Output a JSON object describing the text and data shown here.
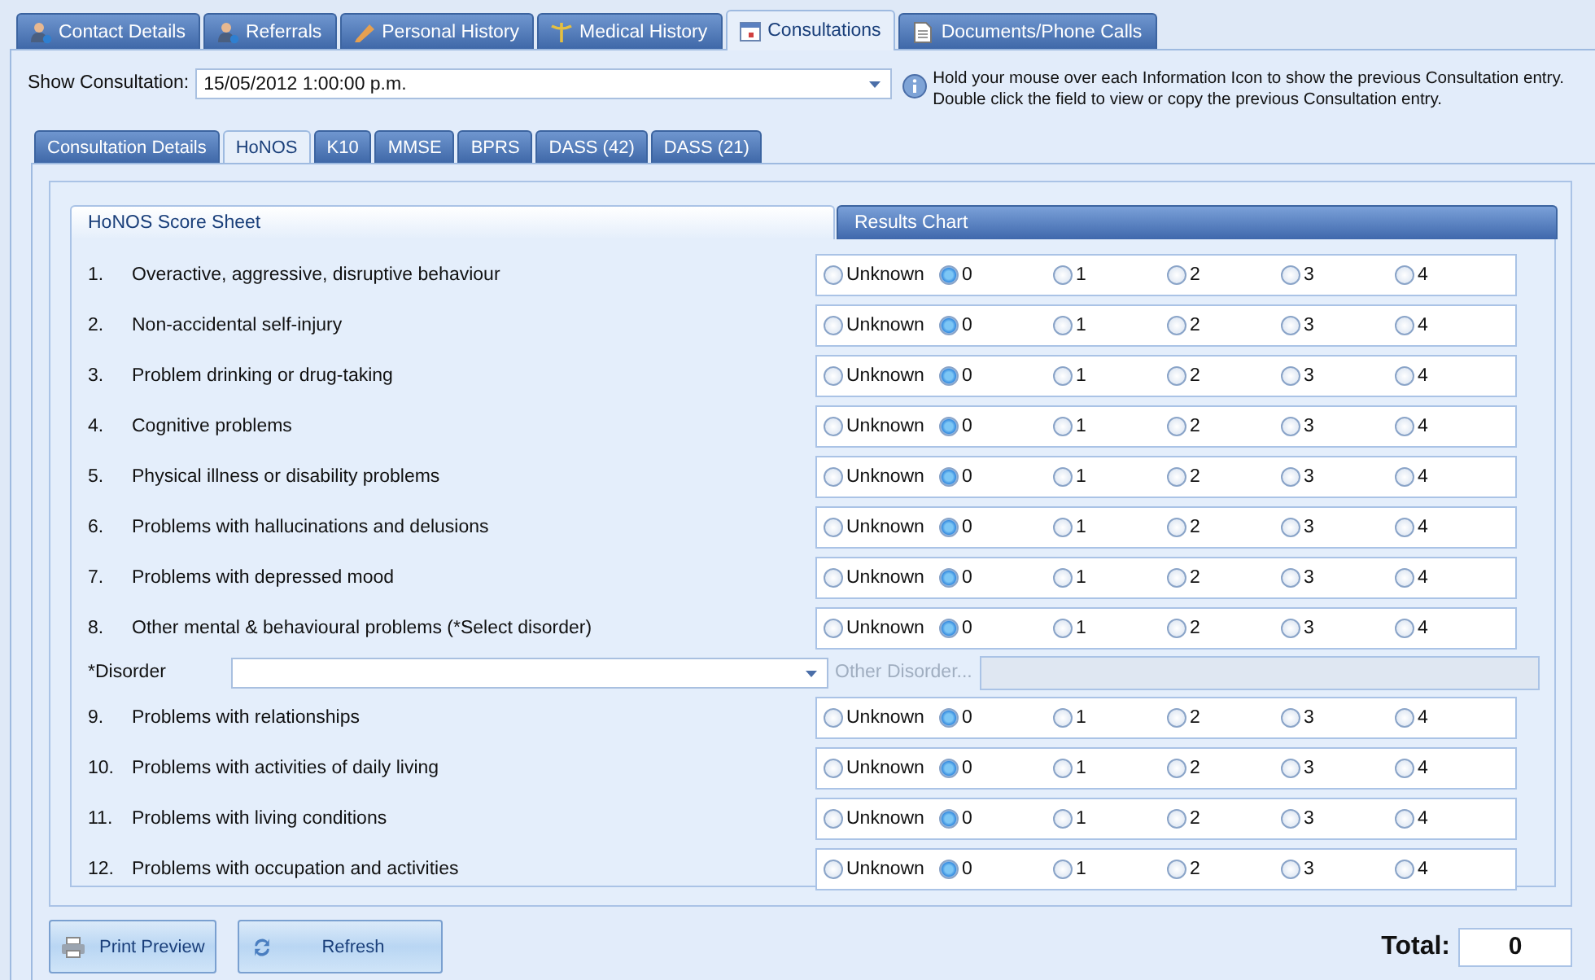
{
  "main_tabs": [
    {
      "label": "Contact Details",
      "selected": false
    },
    {
      "label": "Referrals",
      "selected": false
    },
    {
      "label": "Personal History",
      "selected": false
    },
    {
      "label": "Medical History",
      "selected": false
    },
    {
      "label": "Consultations",
      "selected": true
    },
    {
      "label": "Documents/Phone Calls",
      "selected": false
    }
  ],
  "show_consultation": {
    "label": "Show Consultation:",
    "value": "15/05/2012 1:00:00 p.m."
  },
  "info_text": [
    "Hold your mouse over each Information Icon to show the previous Consultation entry.",
    "Double click the field to view or copy the previous Consultation entry."
  ],
  "sub_tabs": [
    {
      "label": "Consultation Details",
      "selected": false
    },
    {
      "label": "HoNOS",
      "selected": true
    },
    {
      "label": "K10",
      "selected": false
    },
    {
      "label": "MMSE",
      "selected": false
    },
    {
      "label": "BPRS",
      "selected": false
    },
    {
      "label": "DASS (42)",
      "selected": false
    },
    {
      "label": "DASS (21)",
      "selected": false
    }
  ],
  "group_tabs": [
    {
      "label": "HoNOS Score Sheet",
      "selected": true
    },
    {
      "label": "Results Chart",
      "selected": false
    }
  ],
  "items": [
    {
      "kind": "score",
      "number": "1.",
      "label": "Overactive, aggressive, disruptive behaviour",
      "options": [
        {
          "label": "Unknown",
          "selected": false
        },
        {
          "label": "0",
          "selected": true
        },
        {
          "label": "1",
          "selected": false
        },
        {
          "label": "2",
          "selected": false
        },
        {
          "label": "3",
          "selected": false
        },
        {
          "label": "4",
          "selected": false
        }
      ]
    },
    {
      "kind": "score",
      "number": "2.",
      "label": "Non-accidental self-injury",
      "options": [
        {
          "label": "Unknown",
          "selected": false
        },
        {
          "label": "0",
          "selected": true
        },
        {
          "label": "1",
          "selected": false
        },
        {
          "label": "2",
          "selected": false
        },
        {
          "label": "3",
          "selected": false
        },
        {
          "label": "4",
          "selected": false
        }
      ]
    },
    {
      "kind": "score",
      "number": "3.",
      "label": "Problem drinking or drug-taking",
      "options": [
        {
          "label": "Unknown",
          "selected": false
        },
        {
          "label": "0",
          "selected": true
        },
        {
          "label": "1",
          "selected": false
        },
        {
          "label": "2",
          "selected": false
        },
        {
          "label": "3",
          "selected": false
        },
        {
          "label": "4",
          "selected": false
        }
      ]
    },
    {
      "kind": "score",
      "number": "4.",
      "label": "Cognitive problems",
      "options": [
        {
          "label": "Unknown",
          "selected": false
        },
        {
          "label": "0",
          "selected": true
        },
        {
          "label": "1",
          "selected": false
        },
        {
          "label": "2",
          "selected": false
        },
        {
          "label": "3",
          "selected": false
        },
        {
          "label": "4",
          "selected": false
        }
      ]
    },
    {
      "kind": "score",
      "number": "5.",
      "label": "Physical illness or disability problems",
      "options": [
        {
          "label": "Unknown",
          "selected": false
        },
        {
          "label": "0",
          "selected": true
        },
        {
          "label": "1",
          "selected": false
        },
        {
          "label": "2",
          "selected": false
        },
        {
          "label": "3",
          "selected": false
        },
        {
          "label": "4",
          "selected": false
        }
      ]
    },
    {
      "kind": "score",
      "number": "6.",
      "label": "Problems with hallucinations and delusions",
      "options": [
        {
          "label": "Unknown",
          "selected": false
        },
        {
          "label": "0",
          "selected": true
        },
        {
          "label": "1",
          "selected": false
        },
        {
          "label": "2",
          "selected": false
        },
        {
          "label": "3",
          "selected": false
        },
        {
          "label": "4",
          "selected": false
        }
      ]
    },
    {
      "kind": "score",
      "number": "7.",
      "label": "Problems with depressed mood",
      "options": [
        {
          "label": "Unknown",
          "selected": false
        },
        {
          "label": "0",
          "selected": true
        },
        {
          "label": "1",
          "selected": false
        },
        {
          "label": "2",
          "selected": false
        },
        {
          "label": "3",
          "selected": false
        },
        {
          "label": "4",
          "selected": false
        }
      ]
    },
    {
      "kind": "score",
      "number": "8.",
      "label": "Other mental & behavioural problems (*Select disorder)",
      "options": [
        {
          "label": "Unknown",
          "selected": false
        },
        {
          "label": "0",
          "selected": true
        },
        {
          "label": "1",
          "selected": false
        },
        {
          "label": "2",
          "selected": false
        },
        {
          "label": "3",
          "selected": false
        },
        {
          "label": "4",
          "selected": false
        }
      ]
    },
    {
      "kind": "disorder",
      "label": "*Disorder",
      "other_label": "Other Disorder...",
      "other_disabled": true
    },
    {
      "kind": "score",
      "number": "9.",
      "label": "Problems with relationships",
      "options": [
        {
          "label": "Unknown",
          "selected": false
        },
        {
          "label": "0",
          "selected": true
        },
        {
          "label": "1",
          "selected": false
        },
        {
          "label": "2",
          "selected": false
        },
        {
          "label": "3",
          "selected": false
        },
        {
          "label": "4",
          "selected": false
        }
      ]
    },
    {
      "kind": "score",
      "number": "10.",
      "label": "Problems with activities of daily living",
      "options": [
        {
          "label": "Unknown",
          "selected": false
        },
        {
          "label": "0",
          "selected": true
        },
        {
          "label": "1",
          "selected": false
        },
        {
          "label": "2",
          "selected": false
        },
        {
          "label": "3",
          "selected": false
        },
        {
          "label": "4",
          "selected": false
        }
      ]
    },
    {
      "kind": "score",
      "number": "11.",
      "label": "Problems with living conditions",
      "options": [
        {
          "label": "Unknown",
          "selected": false
        },
        {
          "label": "0",
          "selected": true
        },
        {
          "label": "1",
          "selected": false
        },
        {
          "label": "2",
          "selected": false
        },
        {
          "label": "3",
          "selected": false
        },
        {
          "label": "4",
          "selected": false
        }
      ]
    },
    {
      "kind": "score",
      "number": "12.",
      "label": "Problems with occupation and activities",
      "options": [
        {
          "label": "Unknown",
          "selected": false
        },
        {
          "label": "0",
          "selected": true
        },
        {
          "label": "1",
          "selected": false
        },
        {
          "label": "2",
          "selected": false
        },
        {
          "label": "3",
          "selected": false
        },
        {
          "label": "4",
          "selected": false
        }
      ]
    }
  ],
  "buttons": [
    {
      "label": "Print Preview"
    },
    {
      "label": "Refresh"
    }
  ],
  "total": {
    "label": "Total:",
    "value": "0"
  }
}
